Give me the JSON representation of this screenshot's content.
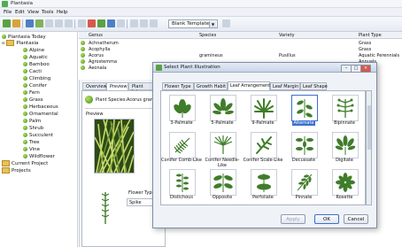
{
  "app": {
    "title": "Plantasia"
  },
  "menu": [
    "File",
    "Edit",
    "View",
    "Tools",
    "Help"
  ],
  "toolbar": {
    "template_value": "Blank Template"
  },
  "tree": {
    "items": [
      {
        "label": "Plantasia Today",
        "level": 0,
        "icon": "leaf-icon"
      },
      {
        "label": "Plantasia",
        "level": 0,
        "icon": "folder-icon"
      },
      {
        "label": "Alpine",
        "level": 1,
        "icon": "leaf-icon"
      },
      {
        "label": "Aquatic",
        "level": 1,
        "icon": "leaf-icon"
      },
      {
        "label": "Bamboo",
        "level": 1,
        "icon": "leaf-icon"
      },
      {
        "label": "Cacti",
        "level": 1,
        "icon": "leaf-icon"
      },
      {
        "label": "Climbing",
        "level": 1,
        "icon": "leaf-icon"
      },
      {
        "label": "Conifer",
        "level": 1,
        "icon": "leaf-icon"
      },
      {
        "label": "Fern",
        "level": 1,
        "icon": "leaf-icon"
      },
      {
        "label": "Grass",
        "level": 1,
        "icon": "leaf-icon"
      },
      {
        "label": "Herbaceous",
        "level": 1,
        "icon": "leaf-icon"
      },
      {
        "label": "Ornamental",
        "level": 1,
        "icon": "leaf-icon"
      },
      {
        "label": "Palm",
        "level": 1,
        "icon": "leaf-icon"
      },
      {
        "label": "Shrub",
        "level": 1,
        "icon": "leaf-icon"
      },
      {
        "label": "Succulent",
        "level": 1,
        "icon": "leaf-icon"
      },
      {
        "label": "Tree",
        "level": 1,
        "icon": "leaf-icon"
      },
      {
        "label": "Vine",
        "level": 1,
        "icon": "leaf-icon"
      },
      {
        "label": "Wildflower",
        "level": 1,
        "icon": "leaf-icon"
      },
      {
        "label": "Current Project",
        "level": 0,
        "icon": "folder-icon"
      },
      {
        "label": "Projects",
        "level": 0,
        "icon": "folder-icon"
      }
    ]
  },
  "table": {
    "headers": [
      "Genus",
      "Species",
      "Variety",
      "Plant Type"
    ],
    "rows": [
      [
        "Achnatherum",
        "",
        "",
        "Grass"
      ],
      [
        "Acophylla",
        "",
        "",
        "Grass"
      ],
      [
        "Acorus",
        "gramineus",
        "Pusillus",
        "Aquatic Perennials"
      ],
      [
        "Agrostemma",
        "",
        "",
        "Annuals"
      ],
      [
        "Aeonala",
        "",
        "",
        ""
      ]
    ]
  },
  "tabs": {
    "items": [
      "Overview",
      "Preview",
      "Plant Intere"
    ],
    "species_label": "Plant Species:",
    "species_value": "Acorus gram",
    "preview_label": "Preview",
    "flower_type_label": "Flower Type",
    "flower_type_value": "Spike"
  },
  "dialog": {
    "title": "Select Plant Illustration",
    "tabs": [
      "Flower Type",
      "Growth Habit",
      "Leaf Arrangement",
      "Leaf Margin",
      "Leaf Shape"
    ],
    "active_tab": "Leaf Arrangement",
    "items": [
      {
        "label": "3-Palmate",
        "icon": "palmate-3-icon"
      },
      {
        "label": "5-Palmate",
        "icon": "palmate-5-icon"
      },
      {
        "label": "9-Palmate",
        "icon": "palmate-9-icon"
      },
      {
        "label": "Alternate",
        "icon": "alternate-leaf-icon",
        "selected": true
      },
      {
        "label": "Bipinnate",
        "icon": "bipinnate-icon"
      },
      {
        "label": "Conifer Comb-Like",
        "icon": "conifer-comb-icon"
      },
      {
        "label": "Conifer Needle-Like",
        "icon": "conifer-needle-icon"
      },
      {
        "label": "Conifer Scale-Like",
        "icon": "conifer-scale-icon"
      },
      {
        "label": "Decussate",
        "icon": "decussate-icon"
      },
      {
        "label": "Digitate",
        "icon": "digitate-icon"
      },
      {
        "label": "Distichous",
        "icon": "distichous-icon"
      },
      {
        "label": "Opposite",
        "icon": "opposite-icon"
      },
      {
        "label": "Perfoliate",
        "icon": "perfoliate-icon"
      },
      {
        "label": "Pinnate",
        "icon": "pinnate-icon"
      },
      {
        "label": "Rosette",
        "icon": "rosette-icon"
      }
    ],
    "buttons": {
      "apply": "Apply",
      "ok": "OK",
      "cancel": "Cancel"
    }
  },
  "colors": {
    "leaf": "#3f7d2a",
    "selection": "#3a6fd0"
  }
}
